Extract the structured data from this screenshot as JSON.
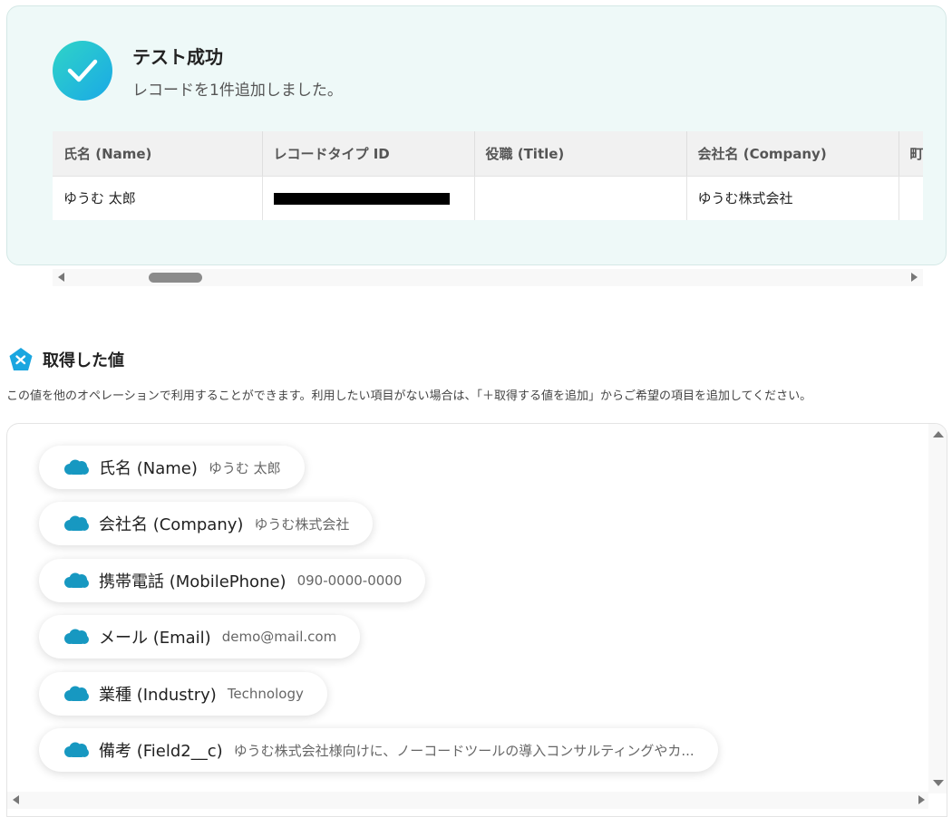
{
  "success": {
    "title": "テスト成功",
    "message": "レコードを1件追加しました。",
    "table": {
      "headers": [
        "氏名 (Name)",
        "レコードタイプ ID",
        "役職 (Title)",
        "会社名 (Company)",
        "町"
      ],
      "row": [
        "ゆうむ 太郎",
        "",
        "",
        "ゆうむ株式会社",
        ""
      ]
    }
  },
  "values_section": {
    "title": "取得した値",
    "description": "この値を他のオペレーションで利用することができます。利用したい項目がない場合は、「＋取得する値を追加」からご希望の項目を追加してください。",
    "items": [
      {
        "label": "氏名 (Name)",
        "value": "ゆうむ 太郎"
      },
      {
        "label": "会社名 (Company)",
        "value": "ゆうむ株式会社"
      },
      {
        "label": "携帯電話 (MobilePhone)",
        "value": "090-0000-0000"
      },
      {
        "label": "メール (Email)",
        "value": "demo@mail.com"
      },
      {
        "label": "業種 (Industry)",
        "value": "Technology"
      },
      {
        "label": "備考 (Field2__c)",
        "value": "ゆうむ株式会社様向けに、ノーコードツールの導入コンサルティングやカ..."
      }
    ]
  },
  "colors": {
    "success_panel_bg": "#eef9f8",
    "check_gradient_start": "#2fd4c7",
    "check_gradient_end": "#1aa9e6",
    "salesforce_blue": "#1798c1",
    "section_icon": "#1aa6e0"
  },
  "icons": {
    "check": "checkmark-icon",
    "section": "yoom-logo-icon",
    "chip": "salesforce-cloud-icon"
  }
}
